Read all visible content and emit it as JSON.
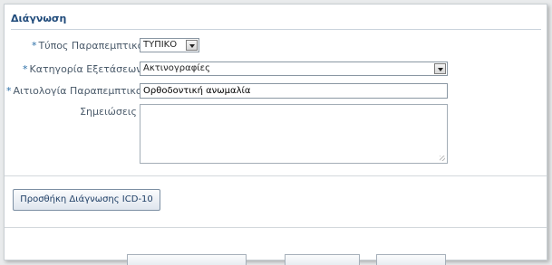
{
  "section": {
    "title": "Διάγνωση"
  },
  "form": {
    "required_mark": "*",
    "referral_type": {
      "label": "Τύπος Παραπεμπτικού",
      "value": "ΤΥΠΙΚΟ"
    },
    "exam_category": {
      "label": "Κατηγορία Εξετάσεων",
      "value": "Ακτινογραφίες"
    },
    "referral_reason": {
      "label": "Αιτιολογία Παραπεμπτικού",
      "value": "Ορθοδοντική ανωμαλία"
    },
    "notes": {
      "label": "Σημειώσεις",
      "value": ""
    }
  },
  "actions": {
    "add_diagnosis_label": "Προσθήκη Διάγνωσης ICD-10"
  },
  "colors": {
    "accent": "#1f4a7a",
    "required": "#2a6ea6"
  }
}
